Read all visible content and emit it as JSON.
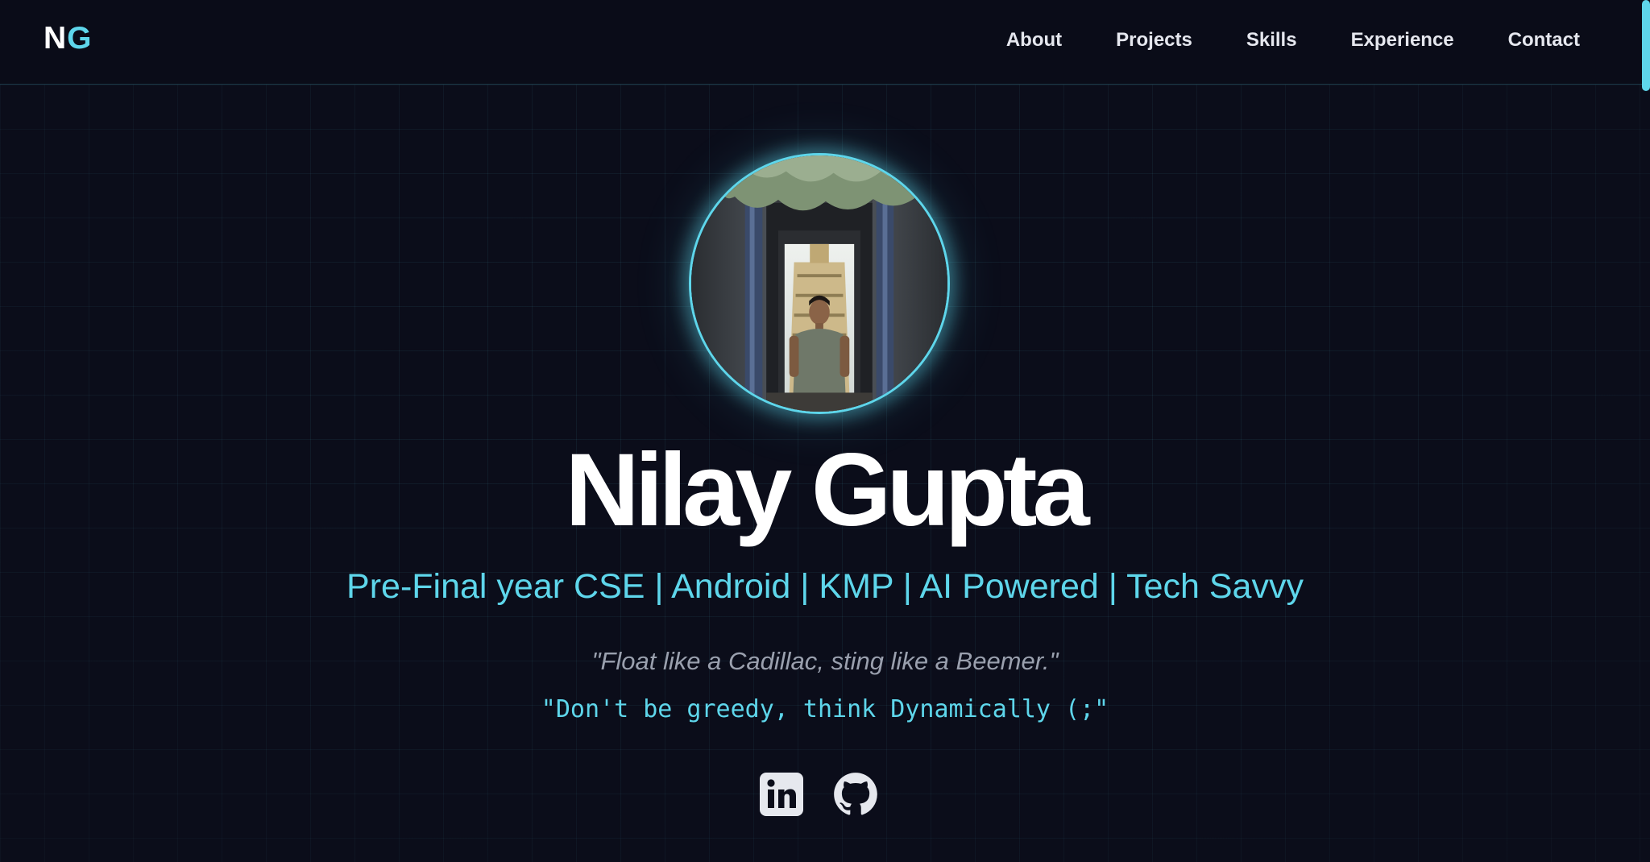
{
  "nav": {
    "logo_n": "N",
    "logo_g": "G",
    "links": [
      "About",
      "Projects",
      "Skills",
      "Experience",
      "Contact"
    ]
  },
  "hero": {
    "name": "Nilay Gupta",
    "tagline": "Pre-Final year CSE | Android | KMP | AI Powered | Tech Savvy",
    "quote": "\"Float like a Cadillac, sting like a Beemer.\"",
    "motto": "\"Don't be greedy, think Dynamically (;\""
  },
  "socials": [
    {
      "icon": "linkedin-icon"
    },
    {
      "icon": "github-icon"
    }
  ],
  "colors": {
    "background": "#0b0d1a",
    "accent": "#5ed6eb",
    "text": "#ffffff",
    "muted": "#9aa0ae"
  }
}
